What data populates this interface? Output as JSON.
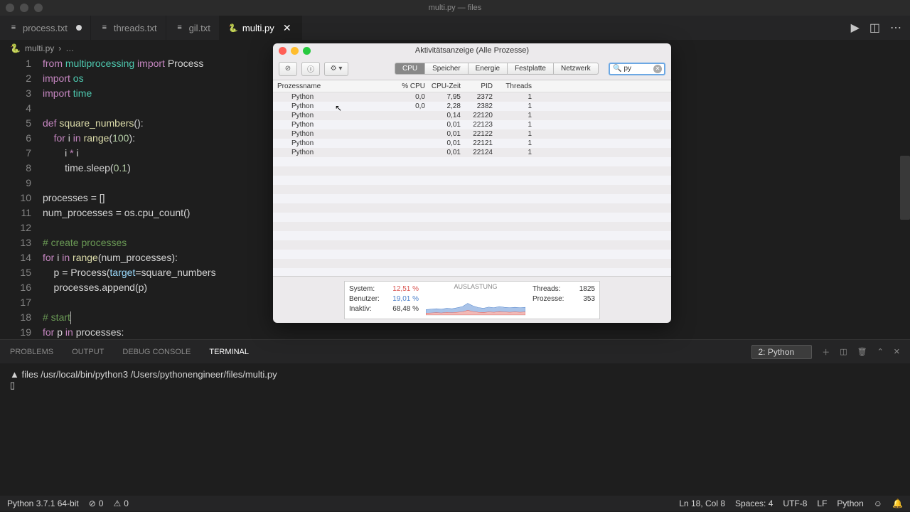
{
  "macos": {
    "title": "multi.py — files"
  },
  "tabs": [
    {
      "icon": "≡",
      "label": "process.txt",
      "modified": true,
      "active": false,
      "iconcolor": "#c5c5c5"
    },
    {
      "icon": "≡",
      "label": "threads.txt",
      "modified": false,
      "active": false,
      "iconcolor": "#c5c5c5"
    },
    {
      "icon": "≡",
      "label": "gil.txt",
      "modified": false,
      "active": false,
      "iconcolor": "#c5c5c5"
    },
    {
      "icon": "🐍",
      "label": "multi.py",
      "modified": false,
      "active": true,
      "close": true,
      "iconcolor": "#3776ab"
    }
  ],
  "breadcrumb": {
    "icon": "🐍",
    "file": "multi.py",
    "sep": "›",
    "more": "…"
  },
  "code": {
    "lines": [
      {
        "n": 1,
        "html": "<span class='kw'>from</span> <span class='mod'>multiprocessing</span> <span class='kw'>import</span> Process"
      },
      {
        "n": 2,
        "html": "<span class='kw'>import</span> <span class='mod'>os</span>"
      },
      {
        "n": 3,
        "html": "<span class='kw'>import</span> <span class='mod'>time</span>"
      },
      {
        "n": 4,
        "html": ""
      },
      {
        "n": 5,
        "html": "<span class='kw'>def</span> <span class='fn'>square_numbers</span>():"
      },
      {
        "n": 6,
        "html": "    <span class='kw'>for</span> i <span class='kw'>in</span> <span class='fn'>range</span>(<span class='num'>100</span>):"
      },
      {
        "n": 7,
        "html": "        i <span class='kw'>*</span> i"
      },
      {
        "n": 8,
        "html": "        time.sleep(<span class='num'>0.1</span>)"
      },
      {
        "n": 9,
        "html": ""
      },
      {
        "n": 10,
        "html": "processes = []"
      },
      {
        "n": 11,
        "html": "num_processes = os.cpu_count()"
      },
      {
        "n": 12,
        "html": ""
      },
      {
        "n": 13,
        "html": "<span class='cmt'># create processes</span>"
      },
      {
        "n": 14,
        "html": "<span class='kw'>for</span> i <span class='kw'>in</span> <span class='fn'>range</span>(num_processes):"
      },
      {
        "n": 15,
        "html": "    p = Process(<span class='param'>target</span>=square_numbers"
      },
      {
        "n": 16,
        "html": "    processes.append(p)"
      },
      {
        "n": 17,
        "html": ""
      },
      {
        "n": 18,
        "html": "<span class='cmt'># start</span><span class='cursor'></span>"
      },
      {
        "n": 19,
        "html": "<span class='kw'>for</span> p <span class='kw'>in</span> processes:"
      }
    ]
  },
  "panel": {
    "problems": "PROBLEMS",
    "output": "OUTPUT",
    "debug": "DEBUG CONSOLE",
    "terminal": "TERMINAL",
    "select": "2: Python"
  },
  "terminal": {
    "line": "files /usr/local/bin/python3 /Users/pythonengineer/files/multi.py"
  },
  "statusbar": {
    "python": "Python 3.7.1 64-bit",
    "errors": "0",
    "warnings": "0",
    "cursor": "Ln 18, Col 8",
    "spaces": "Spaces: 4",
    "encoding": "UTF-8",
    "eol": "LF",
    "lang": "Python",
    "smile": "☺"
  },
  "activity": {
    "title": "Aktivitätsanzeige (Alle Prozesse)",
    "segments": [
      "CPU",
      "Speicher",
      "Energie",
      "Festplatte",
      "Netzwerk"
    ],
    "search_icon": "🔍",
    "search_value": "py",
    "headers": {
      "name": "Prozessname",
      "cpu": "% CPU",
      "time": "CPU-Zeit",
      "pid": "PID",
      "threads": "Threads"
    },
    "rows": [
      {
        "name": "Python",
        "cpu": "0,0",
        "time": "7,95",
        "pid": "2372",
        "threads": "1"
      },
      {
        "name": "Python",
        "cpu": "0,0",
        "time": "2,28",
        "pid": "2382",
        "threads": "1"
      },
      {
        "name": "Python",
        "cpu": "",
        "time": "0,14",
        "pid": "22120",
        "threads": "1"
      },
      {
        "name": "Python",
        "cpu": "",
        "time": "0,01",
        "pid": "22123",
        "threads": "1"
      },
      {
        "name": "Python",
        "cpu": "",
        "time": "0,01",
        "pid": "22122",
        "threads": "1"
      },
      {
        "name": "Python",
        "cpu": "",
        "time": "0,01",
        "pid": "22121",
        "threads": "1"
      },
      {
        "name": "Python",
        "cpu": "",
        "time": "0,01",
        "pid": "22124",
        "threads": "1"
      }
    ],
    "footer": {
      "system_label": "System:",
      "system_val": "12,51 %",
      "user_label": "Benutzer:",
      "user_val": "19,01 %",
      "idle_label": "Inaktiv:",
      "idle_val": "68,48 %",
      "chart_title": "AUSLASTUNG",
      "threads_label": "Threads:",
      "threads_val": "1825",
      "procs_label": "Prozesse:",
      "procs_val": "353"
    }
  },
  "chart_data": {
    "type": "area",
    "title": "AUSLASTUNG",
    "series": [
      {
        "name": "System",
        "color": "#d9534f",
        "values": [
          8,
          9,
          10,
          9,
          11,
          10,
          12,
          14,
          20,
          15,
          12,
          11,
          13,
          12,
          14,
          13,
          12,
          13,
          12,
          13
        ]
      },
      {
        "name": "Benutzer",
        "color": "#4a7fc9",
        "values": [
          15,
          16,
          17,
          16,
          18,
          17,
          19,
          22,
          30,
          24,
          20,
          18,
          21,
          19,
          22,
          20,
          19,
          20,
          19,
          20
        ]
      }
    ],
    "ylim": [
      0,
      100
    ]
  }
}
